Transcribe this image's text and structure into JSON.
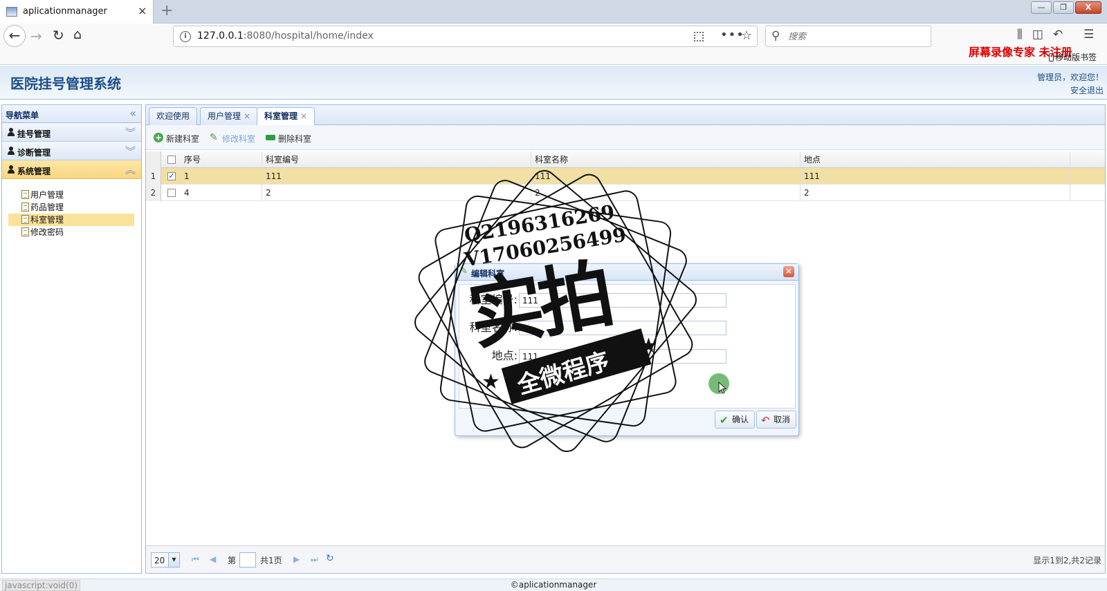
{
  "browser": {
    "tab_title": "aplicationmanager",
    "tab_close": "×",
    "new_tab": "+",
    "url_host": "127.0.0.1",
    "url_rest": ":8080/hospital/home/index",
    "search_placeholder": "搜索",
    "recorder_watermark": "屏幕录像专家  未注册",
    "mobile_bookmarks": "移动版书签",
    "win_minimize": "—",
    "win_restore": "❐",
    "win_close": "X"
  },
  "app": {
    "title": "医院挂号管理系统",
    "welcome": "管理员，欢迎您！",
    "logout": "安全退出"
  },
  "sidebar": {
    "header": "导航菜单",
    "sections": [
      {
        "label": "挂号管理"
      },
      {
        "label": "诊断管理"
      },
      {
        "label": "系统管理"
      }
    ],
    "items": [
      {
        "label": "用户管理"
      },
      {
        "label": "药品管理"
      },
      {
        "label": "科室管理"
      },
      {
        "label": "修改密码"
      }
    ]
  },
  "tabs": [
    {
      "label": "欢迎使用"
    },
    {
      "label": "用户管理"
    },
    {
      "label": "科室管理"
    }
  ],
  "toolbar": {
    "new_label": "新建科室",
    "edit_label": "修改科室",
    "delete_label": "删除科室"
  },
  "grid": {
    "columns": [
      "序号",
      "科室编号",
      "科室名称",
      "地点"
    ],
    "rows": [
      {
        "num": "1",
        "checked": true,
        "seq": "1",
        "code": "111",
        "name": "111",
        "location": "111"
      },
      {
        "num": "2",
        "checked": false,
        "seq": "4",
        "code": "2",
        "name": "2",
        "location": "2"
      }
    ]
  },
  "pager": {
    "page_size": "20",
    "page_prefix": "第",
    "page_value": "",
    "page_suffix": "共1页",
    "info": "显示1到2,共2记录"
  },
  "dialog": {
    "title": "编辑科室",
    "fields": [
      {
        "label": "科室编号:",
        "value": "111"
      },
      {
        "label": "科室名称:",
        "value": ""
      },
      {
        "label": "地点:",
        "value": "111"
      }
    ],
    "ok_label": "确认",
    "cancel_label": "取消"
  },
  "stamp": {
    "qq": "Q2196316269",
    "wechat": "V17060256499",
    "big_text": "实拍",
    "ribbon_text": "全微程序"
  },
  "statusbar": {
    "link": "javascript:void(0)",
    "copyright": "©aplicationmanager"
  }
}
